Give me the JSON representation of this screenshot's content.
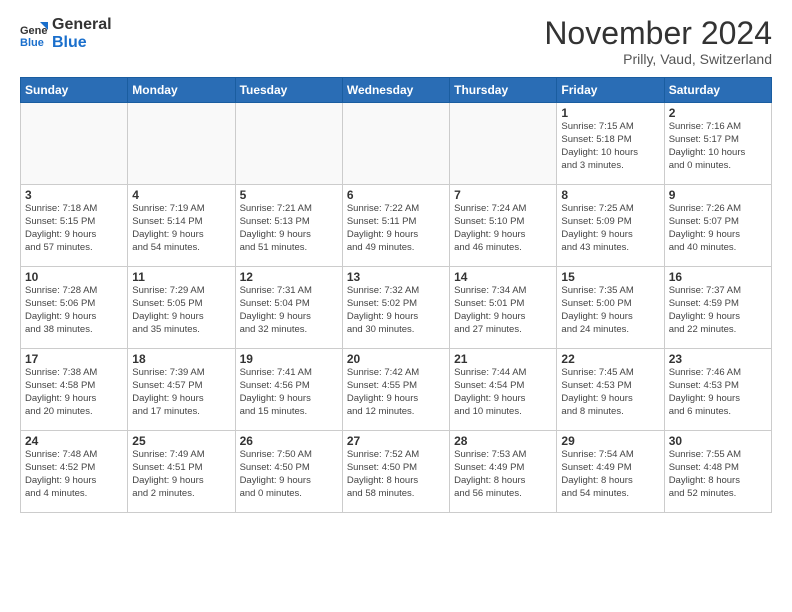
{
  "header": {
    "logo_general": "General",
    "logo_blue": "Blue",
    "month_year": "November 2024",
    "location": "Prilly, Vaud, Switzerland"
  },
  "weekdays": [
    "Sunday",
    "Monday",
    "Tuesday",
    "Wednesday",
    "Thursday",
    "Friday",
    "Saturday"
  ],
  "weeks": [
    [
      {
        "day": "",
        "info": ""
      },
      {
        "day": "",
        "info": ""
      },
      {
        "day": "",
        "info": ""
      },
      {
        "day": "",
        "info": ""
      },
      {
        "day": "",
        "info": ""
      },
      {
        "day": "1",
        "info": "Sunrise: 7:15 AM\nSunset: 5:18 PM\nDaylight: 10 hours\nand 3 minutes."
      },
      {
        "day": "2",
        "info": "Sunrise: 7:16 AM\nSunset: 5:17 PM\nDaylight: 10 hours\nand 0 minutes."
      }
    ],
    [
      {
        "day": "3",
        "info": "Sunrise: 7:18 AM\nSunset: 5:15 PM\nDaylight: 9 hours\nand 57 minutes."
      },
      {
        "day": "4",
        "info": "Sunrise: 7:19 AM\nSunset: 5:14 PM\nDaylight: 9 hours\nand 54 minutes."
      },
      {
        "day": "5",
        "info": "Sunrise: 7:21 AM\nSunset: 5:13 PM\nDaylight: 9 hours\nand 51 minutes."
      },
      {
        "day": "6",
        "info": "Sunrise: 7:22 AM\nSunset: 5:11 PM\nDaylight: 9 hours\nand 49 minutes."
      },
      {
        "day": "7",
        "info": "Sunrise: 7:24 AM\nSunset: 5:10 PM\nDaylight: 9 hours\nand 46 minutes."
      },
      {
        "day": "8",
        "info": "Sunrise: 7:25 AM\nSunset: 5:09 PM\nDaylight: 9 hours\nand 43 minutes."
      },
      {
        "day": "9",
        "info": "Sunrise: 7:26 AM\nSunset: 5:07 PM\nDaylight: 9 hours\nand 40 minutes."
      }
    ],
    [
      {
        "day": "10",
        "info": "Sunrise: 7:28 AM\nSunset: 5:06 PM\nDaylight: 9 hours\nand 38 minutes."
      },
      {
        "day": "11",
        "info": "Sunrise: 7:29 AM\nSunset: 5:05 PM\nDaylight: 9 hours\nand 35 minutes."
      },
      {
        "day": "12",
        "info": "Sunrise: 7:31 AM\nSunset: 5:04 PM\nDaylight: 9 hours\nand 32 minutes."
      },
      {
        "day": "13",
        "info": "Sunrise: 7:32 AM\nSunset: 5:02 PM\nDaylight: 9 hours\nand 30 minutes."
      },
      {
        "day": "14",
        "info": "Sunrise: 7:34 AM\nSunset: 5:01 PM\nDaylight: 9 hours\nand 27 minutes."
      },
      {
        "day": "15",
        "info": "Sunrise: 7:35 AM\nSunset: 5:00 PM\nDaylight: 9 hours\nand 24 minutes."
      },
      {
        "day": "16",
        "info": "Sunrise: 7:37 AM\nSunset: 4:59 PM\nDaylight: 9 hours\nand 22 minutes."
      }
    ],
    [
      {
        "day": "17",
        "info": "Sunrise: 7:38 AM\nSunset: 4:58 PM\nDaylight: 9 hours\nand 20 minutes."
      },
      {
        "day": "18",
        "info": "Sunrise: 7:39 AM\nSunset: 4:57 PM\nDaylight: 9 hours\nand 17 minutes."
      },
      {
        "day": "19",
        "info": "Sunrise: 7:41 AM\nSunset: 4:56 PM\nDaylight: 9 hours\nand 15 minutes."
      },
      {
        "day": "20",
        "info": "Sunrise: 7:42 AM\nSunset: 4:55 PM\nDaylight: 9 hours\nand 12 minutes."
      },
      {
        "day": "21",
        "info": "Sunrise: 7:44 AM\nSunset: 4:54 PM\nDaylight: 9 hours\nand 10 minutes."
      },
      {
        "day": "22",
        "info": "Sunrise: 7:45 AM\nSunset: 4:53 PM\nDaylight: 9 hours\nand 8 minutes."
      },
      {
        "day": "23",
        "info": "Sunrise: 7:46 AM\nSunset: 4:53 PM\nDaylight: 9 hours\nand 6 minutes."
      }
    ],
    [
      {
        "day": "24",
        "info": "Sunrise: 7:48 AM\nSunset: 4:52 PM\nDaylight: 9 hours\nand 4 minutes."
      },
      {
        "day": "25",
        "info": "Sunrise: 7:49 AM\nSunset: 4:51 PM\nDaylight: 9 hours\nand 2 minutes."
      },
      {
        "day": "26",
        "info": "Sunrise: 7:50 AM\nSunset: 4:50 PM\nDaylight: 9 hours\nand 0 minutes."
      },
      {
        "day": "27",
        "info": "Sunrise: 7:52 AM\nSunset: 4:50 PM\nDaylight: 8 hours\nand 58 minutes."
      },
      {
        "day": "28",
        "info": "Sunrise: 7:53 AM\nSunset: 4:49 PM\nDaylight: 8 hours\nand 56 minutes."
      },
      {
        "day": "29",
        "info": "Sunrise: 7:54 AM\nSunset: 4:49 PM\nDaylight: 8 hours\nand 54 minutes."
      },
      {
        "day": "30",
        "info": "Sunrise: 7:55 AM\nSunset: 4:48 PM\nDaylight: 8 hours\nand 52 minutes."
      }
    ]
  ]
}
